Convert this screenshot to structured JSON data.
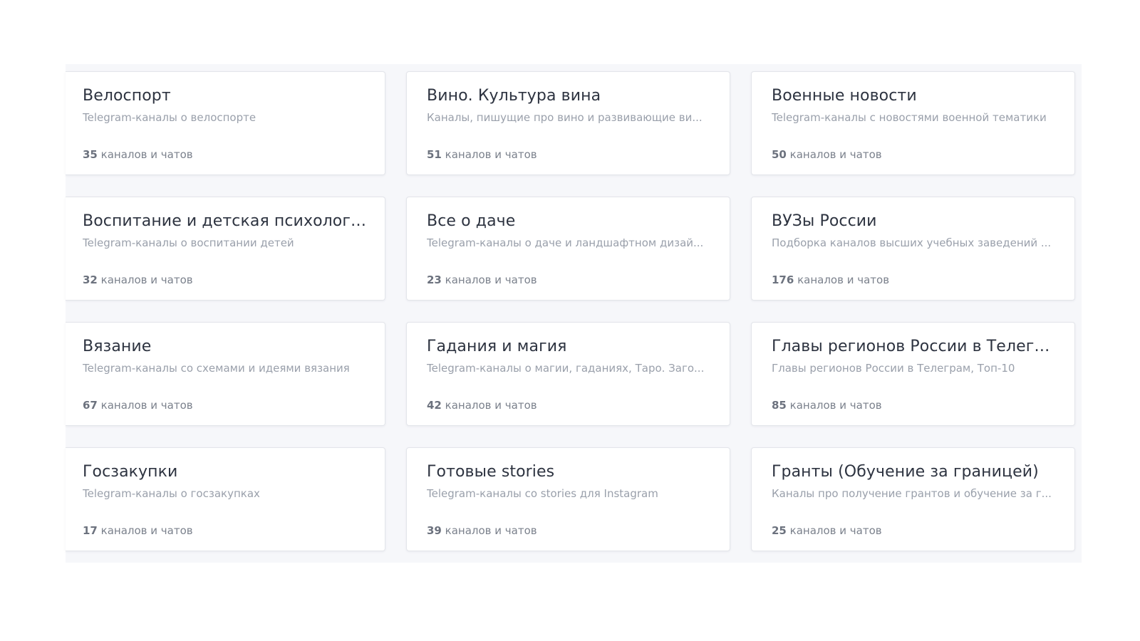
{
  "categories": [
    {
      "title": "Велоспорт",
      "description": "Telegram-каналы о велоспорте",
      "count": "35",
      "count_suffix": " каналов и чатов"
    },
    {
      "title": "Вино. Культура вина",
      "description": "Каналы, пишущие про вино и развивающие ви...",
      "count": "51",
      "count_suffix": " каналов и чатов"
    },
    {
      "title": "Военные новости",
      "description": "Telegram-каналы с новостями военной тематики",
      "count": "50",
      "count_suffix": " каналов и чатов"
    },
    {
      "title": "Воспитание и детская психология",
      "description": "Telegram-каналы о воспитании детей",
      "count": "32",
      "count_suffix": " каналов и чатов"
    },
    {
      "title": "Все о даче",
      "description": "Telegram-каналы о даче и ландшафтном дизай...",
      "count": "23",
      "count_suffix": " каналов и чатов"
    },
    {
      "title": "ВУЗы России",
      "description": "Подборка каналов высших учебных заведений ...",
      "count": "176",
      "count_suffix": " каналов и чатов"
    },
    {
      "title": "Вязание",
      "description": "Telegram-каналы со схемами и идеями вязания",
      "count": "67",
      "count_suffix": " каналов и чатов"
    },
    {
      "title": "Гадания и магия",
      "description": "Telegram-каналы о магии, гаданиях, Таро. Заго...",
      "count": "42",
      "count_suffix": " каналов и чатов"
    },
    {
      "title": "Главы регионов России в Телегра...",
      "description": "Главы регионов России в Телеграм, Топ-10",
      "count": "85",
      "count_suffix": " каналов и чатов"
    },
    {
      "title": "Госзакупки",
      "description": "Telegram-каналы о госзакупках",
      "count": "17",
      "count_suffix": " каналов и чатов"
    },
    {
      "title": "Готовые stories",
      "description": "Telegram-каналы со stories для Instagram",
      "count": "39",
      "count_suffix": " каналов и чатов"
    },
    {
      "title": "Гранты (Обучение за границей)",
      "description": "Каналы про получение грантов и обучение за г...",
      "count": "25",
      "count_suffix": " каналов и чатов"
    }
  ]
}
